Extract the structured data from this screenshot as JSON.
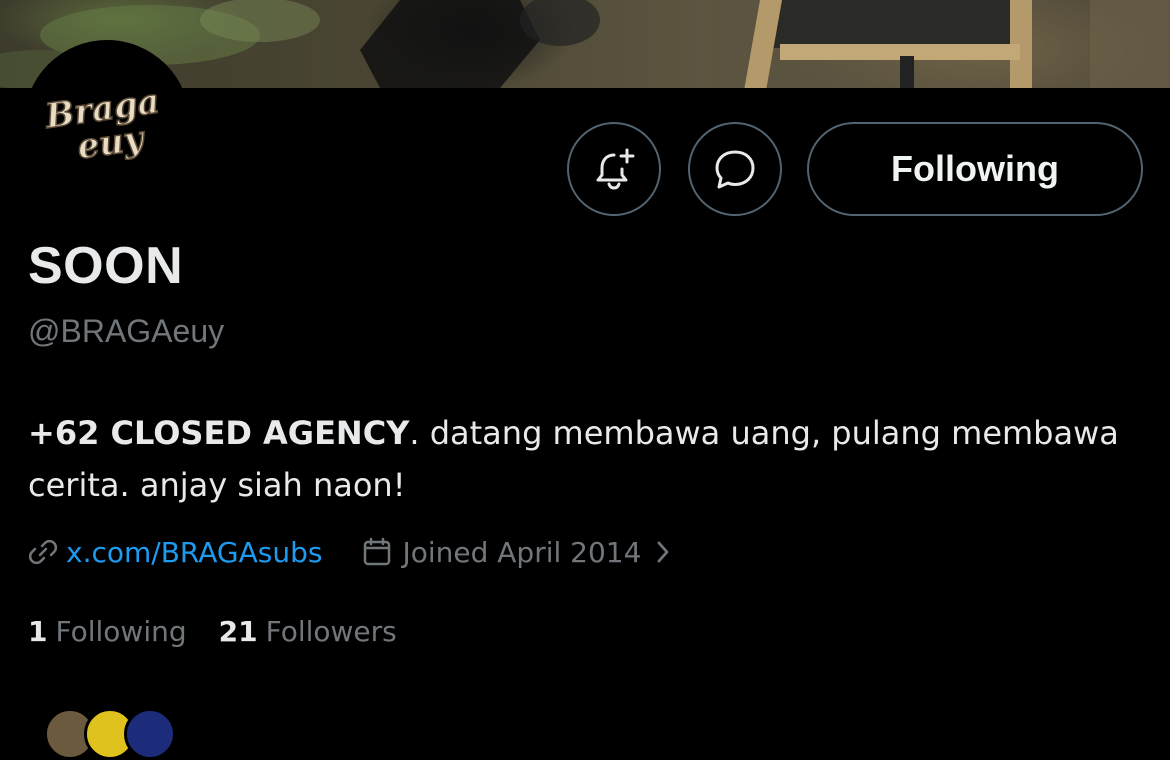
{
  "profile": {
    "display_name": "SOON",
    "handle": "@BRAGAeuy",
    "avatar_text_line1": "Braga",
    "avatar_text_line2": "euy",
    "bio_bold": "+62 CLOSED AGENCY",
    "bio_rest": ". datang membawa uang, pulang membawa cerita. anjay siah naon!",
    "website": "x.com/BRAGAsubs",
    "joined": "Joined April 2014"
  },
  "actions": {
    "notify_icon": "bell-plus-icon",
    "message_icon": "chat-bubble-icon",
    "follow_button_label": "Following"
  },
  "stats": {
    "following_count": "1",
    "following_label": "Following",
    "followers_count": "21",
    "followers_label": "Followers"
  },
  "colors": {
    "background": "#000000",
    "text_primary": "#e7e9ea",
    "text_secondary": "#71767b",
    "link": "#1d9bf0",
    "border": "#536471"
  }
}
